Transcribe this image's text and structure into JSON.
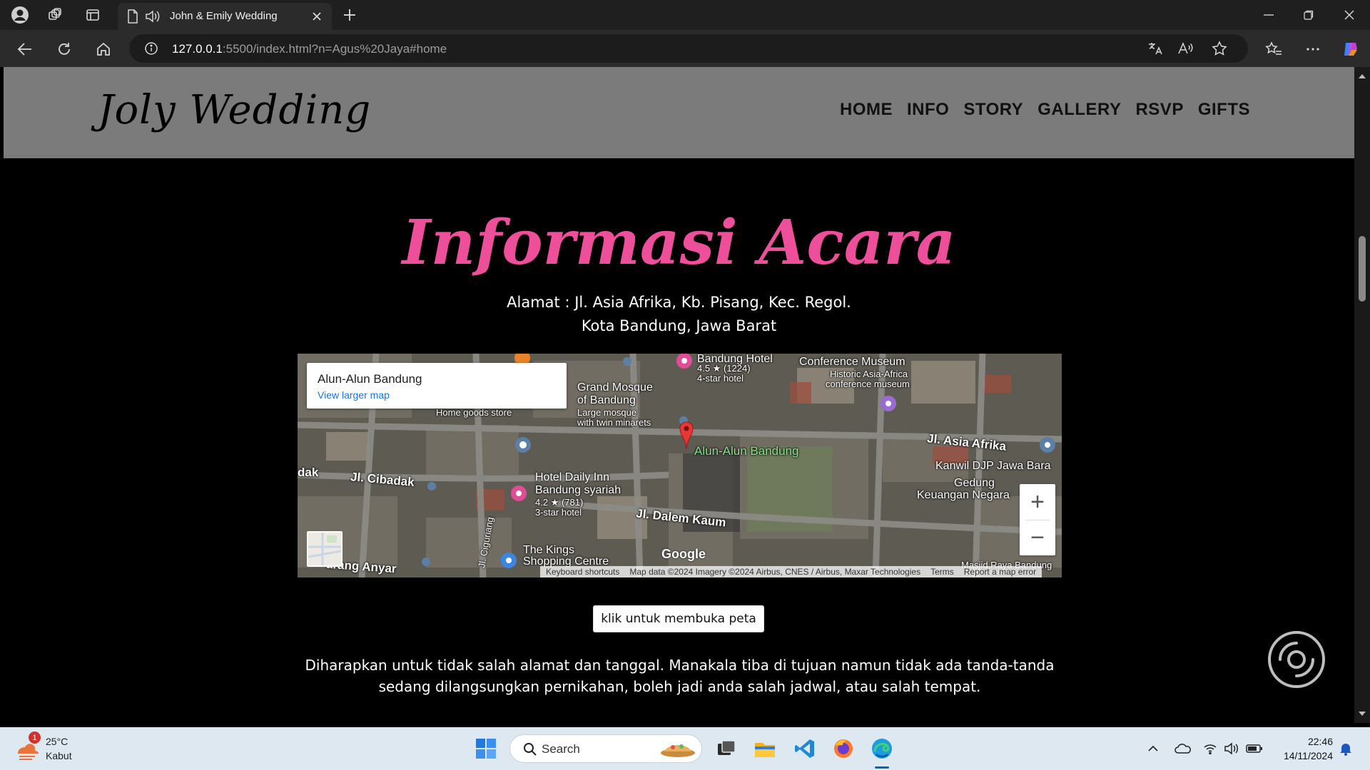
{
  "browser": {
    "tab_title": "John & Emily Wedding",
    "url_host": "127.0.0.1",
    "url_rest": ":5500/index.html?n=Agus%20Jaya#home"
  },
  "site": {
    "brand": "Joly Wedding",
    "menu": [
      "HOME",
      "INFO",
      "STORY",
      "GALLERY",
      "RSVP",
      "GIFTS"
    ]
  },
  "info": {
    "title": "Informasi Acara",
    "address_line1": "Alamat : Jl. Asia Afrika, Kb. Pisang, Kec. Regol.",
    "address_line2": "Kota Bandung, Jawa Barat",
    "open_map_button": "klik untuk membuka peta",
    "description": "Diharapkan untuk tidak salah alamat dan tanggal. Manakala tiba di tujuan namun tidak ada tanda-tanda sedang dilangsungkan pernikahan, boleh jadi anda salah jadwal, atau salah tempat."
  },
  "map": {
    "place_name": "Alun-Alun Bandung",
    "view_larger": "View larger map",
    "zoom_in": "+",
    "zoom_out": "−",
    "google": "Google",
    "attribution": {
      "shortcuts": "Keyboard shortcuts",
      "data": "Map data ©2024 Imagery ©2024 Airbus, CNES / Airbus, Maxar Technologies",
      "terms": "Terms",
      "report": "Report a map error"
    },
    "labels": {
      "hotel_top": "Bandung Hotel",
      "hotel_top_rating": "4.5 ★ (1224)",
      "hotel_top_class": "4-star hotel",
      "museum": "Conference Museum",
      "museum_sub1": "Historic Asia-Africa",
      "museum_sub2": "conference museum",
      "mosque": "Grand Mosque",
      "mosque2": "of Bandung",
      "mosque_sub1": "Large mosque",
      "mosque_sub2": "with twin minarets",
      "home_goods": "Home goods store",
      "street_asia": "Jl. Asia Afrika",
      "kanwil": "Kanwil DJP Jawa Bara",
      "gedung1": "Gedung",
      "gedung2": "Keuangan Negara",
      "street_cibadak": "Jl. Cibadak",
      "dak": "dak",
      "hotel_daily": "Hotel Daily Inn",
      "hotel_daily2": "Bandung syariah",
      "hotel_daily_rating": "4.2 ★ (781)",
      "hotel_daily_class": "3-star hotel",
      "street_dalem": "Jl. Dalem Kaum",
      "street_cigu": "Jl. Ciguriang",
      "kings1": "The Kings",
      "kings2": "Shopping Centre",
      "karang": "arang Anyar",
      "merdeka": "Masjid Raya Bandung"
    }
  },
  "taskbar": {
    "weather_temp": "25°C",
    "weather_desc": "Kabut",
    "weather_badge": "1",
    "search": "Search",
    "time": "22:46",
    "date": "14/11/2024"
  },
  "colors": {
    "title_pink": "#ee4f9a",
    "header_gray": "#7b7b7b",
    "map_link_blue": "#1a73e8"
  }
}
